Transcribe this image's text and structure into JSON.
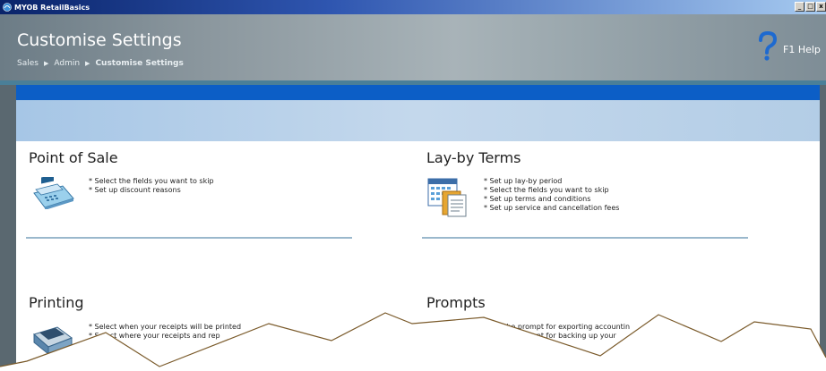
{
  "window": {
    "title": "MYOB RetailBasics",
    "buttons": [
      "_",
      "□",
      "x"
    ]
  },
  "header": {
    "title": "Customise Settings",
    "breadcrumb": [
      "Sales",
      "Admin",
      "Customise Settings"
    ],
    "help_label": "F1 Help"
  },
  "sections": {
    "point_of_sale": {
      "title": "Point of Sale",
      "icon": "cash-register-icon",
      "bullets": [
        "* Select the fields you want to skip",
        "* Set up discount reasons"
      ]
    },
    "layby": {
      "title": "Lay-by Terms",
      "icon": "calendar-document-icon",
      "bullets": [
        "* Set up lay-by period",
        "* Select the fields you want to skip",
        "* Set up terms and conditions",
        "* Set up service and cancellation fees"
      ]
    },
    "printing": {
      "title": "Printing",
      "icon": "printer-icon",
      "bullets": [
        "* Select when your receipts will be printed",
        "* Select where your receipts and rep"
      ]
    },
    "prompts": {
      "title": "Prompts",
      "bullets": [
        "* Set the prompt for exporting accountin",
        "* Set the prompt for backing up your"
      ]
    }
  },
  "colors": {
    "titlebar": "#0a246a",
    "header": "#8b979e",
    "accent_band": "#0c5ec6",
    "rule": "#9ab8cc",
    "tear_line": "#7a5a2a"
  }
}
